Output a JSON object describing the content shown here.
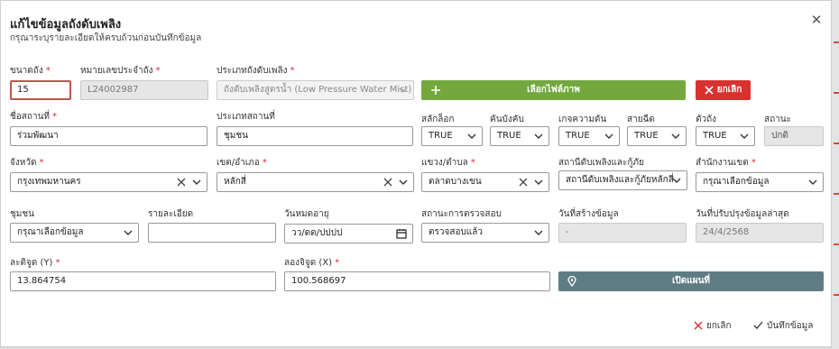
{
  "dialog": {
    "title": "แก้ไขข้อมูลถังดับเพลิง",
    "subtitle": "กรุณาระบุรายละเอียดให้ครบถ้วนก่อนบันทึกข้อมูล"
  },
  "fields": {
    "size": {
      "label": "ขนาดถัง",
      "value": "15"
    },
    "tank_no": {
      "label": "หมายเลขประจำถัง",
      "value": "L24002987"
    },
    "tank_type": {
      "label": "ประเภทถังดับเพลิง",
      "value": "ถังดับเพลิงสูตรน้ำ (Low Pressure Water Mist)"
    },
    "place_name": {
      "label": "ชื่อสถานที่",
      "value": "ร่วมพัฒนา"
    },
    "place_type": {
      "label": "ประเภทสถานที่",
      "value": "ชุมชน"
    },
    "pin_lock": {
      "label": "สลักล็อก",
      "value": "TRUE"
    },
    "handle": {
      "label": "คันบังคับ",
      "value": "TRUE"
    },
    "gauge": {
      "label": "เกจความดัน",
      "value": "TRUE"
    },
    "hose": {
      "label": "สายฉีด",
      "value": "TRUE"
    },
    "body": {
      "label": "ตัวถัง",
      "value": "TRUE"
    },
    "status": {
      "label": "สถานะ",
      "value": "ปกติ"
    },
    "province": {
      "label": "จังหวัด",
      "value": "กรุงเทพมหานคร"
    },
    "district": {
      "label": "เขต/อำเภอ",
      "value": "หลักสี่"
    },
    "subdistrict": {
      "label": "แขวง/ตำบล",
      "value": "ตลาดบางเขน"
    },
    "fire_station": {
      "label": "สถานีดับเพลิงและกู้ภัย",
      "value": "สถานีดับเพลิงและกู้ภัยหลักสี่"
    },
    "district_office": {
      "label": "สำนักงานเขต",
      "value": "กรุณาเลือกข้อมูล"
    },
    "community": {
      "label": "ชุมชน",
      "value": "กรุณาเลือกข้อมูล"
    },
    "details": {
      "label": "รายละเอียด",
      "value": ""
    },
    "expiry": {
      "label": "วันหมดอายุ",
      "value": "วว/ดด/ปปปป"
    },
    "inspection": {
      "label": "สถานะการตรวจสอบ",
      "value": "ตรวจสอบแล้ว"
    },
    "created": {
      "label": "วันที่สร้างข้อมูล",
      "value": "-"
    },
    "updated": {
      "label": "วันที่ปรับปรุงข้อมูลล่าสุด",
      "value": "24/4/2568"
    },
    "latitude": {
      "label": "ละติจูด (Y)",
      "value": "13.864754"
    },
    "longitude": {
      "label": "ลองจิจูด (X)",
      "value": "100.568697"
    }
  },
  "buttons": {
    "choose_image": "เลือกไฟล์ภาพ",
    "cancel_image": "ยกเลิก",
    "open_map": "เปิดแผนที่",
    "cancel": "ยกเลิก",
    "save": "บันทึกข้อมูล"
  },
  "colors": {
    "accent_green": "#72a83e",
    "danger_red": "#d9312f",
    "map_button": "#5f7c85",
    "required": "#d32f2f"
  },
  "icons": [
    "close-icon",
    "plus-icon",
    "x-icon",
    "chevron-down-icon",
    "clear-icon",
    "calendar-icon",
    "map-pin-icon",
    "check-icon"
  ]
}
